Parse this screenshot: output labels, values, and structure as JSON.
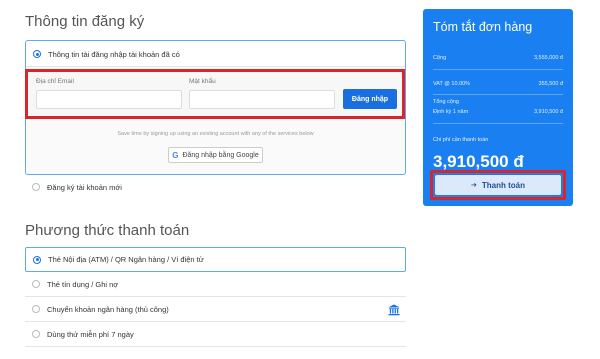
{
  "registration": {
    "title": "Thông tin đăng ký",
    "option_existing": "Thông tin tài đăng nhập tài khoản đã có",
    "email_label": "Địa chỉ Email",
    "email_value": "",
    "password_label": "Mật khẩu",
    "password_value": "",
    "login_button": "Đăng nhập",
    "social_hint": "Save time by signing up using an existing account with any of the services below",
    "google_button": "Đăng nhập bằng Google",
    "option_new": "Đăng ký tài khoản mới"
  },
  "payment": {
    "title": "Phương thức thanh toán",
    "methods": [
      {
        "label": "Thẻ Nội địa (ATM) / QR Ngân hàng / Ví điện tử",
        "selected": true
      },
      {
        "label": "Thẻ tín dụng / Ghi nợ",
        "selected": false
      },
      {
        "label": "Chuyển khoản ngân hàng (thủ công)",
        "selected": false,
        "icon": "bank-icon"
      },
      {
        "label": "Dùng thử miễn phí 7 ngày",
        "selected": false
      }
    ]
  },
  "summary": {
    "title": "Tóm tắt đơn hàng",
    "subtotal_label": "Cộng",
    "subtotal_value": "3,555,000 đ",
    "vat_label": "VAT @ 10.00%",
    "vat_value": "355,500 đ",
    "total_label": "Tổng cộng",
    "period_label": "Định kỳ 1 năm",
    "period_value": "3,910,500 đ",
    "due_label": "Chi phí cần thanh toán",
    "due_value": "3,910,500 đ",
    "checkout_button": "Thanh toán"
  },
  "colors": {
    "accent": "#1a7ff0",
    "highlight": "#d9262d"
  }
}
